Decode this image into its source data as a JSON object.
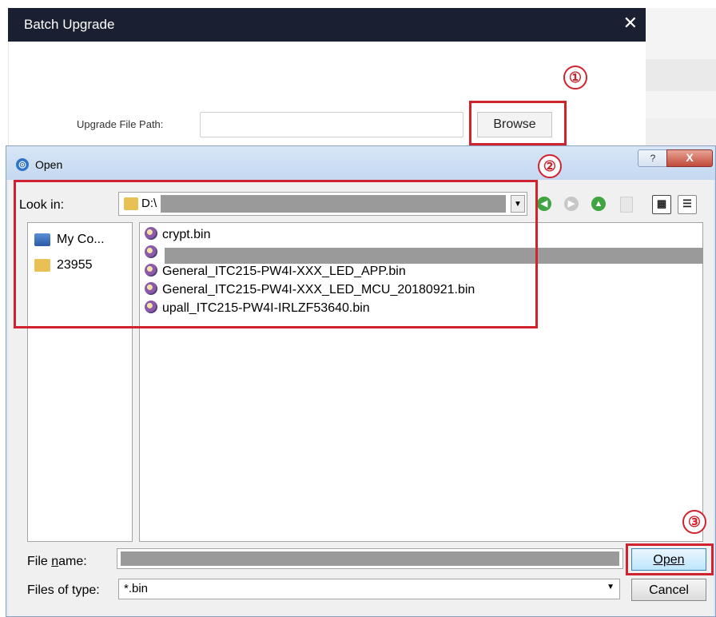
{
  "batch_upgrade": {
    "title": "Batch Upgrade",
    "close_glyph": "✕",
    "upgrade_path_label": "Upgrade File Path:",
    "upgrade_path_value": "",
    "browse_label": "Browse"
  },
  "open_dialog": {
    "title": "Open",
    "help_glyph": "?",
    "close_glyph": "X",
    "look_in_label": "Look in:",
    "look_in_value": "D:\\",
    "places": [
      {
        "label": "My Co...",
        "icon": "my-computer-icon"
      },
      {
        "label": "23955",
        "icon": "user-folder-icon"
      }
    ],
    "files": [
      {
        "name": "crypt.bin"
      },
      {
        "name": ""
      },
      {
        "name": "General_ITC215-PW4I-XXX_LED_APP.bin"
      },
      {
        "name": "General_ITC215-PW4I-XXX_LED_MCU_20180921.bin"
      },
      {
        "name": "upall_ITC215-PW4I-IRLZF53640.bin"
      }
    ],
    "file_name_label": "File name:",
    "file_name_value": "",
    "files_of_type_label": "Files of type:",
    "files_of_type_value": "*.bin",
    "open_label": "Open",
    "cancel_label": "Cancel"
  },
  "annotations": {
    "step1": "①",
    "step2": "②",
    "step3": "③",
    "highlight_color": "#d0232f"
  },
  "colors": {
    "titlebar": "#1a2031",
    "dialog_frame": "#dce7f5",
    "redaction": "#9a9a9a"
  }
}
